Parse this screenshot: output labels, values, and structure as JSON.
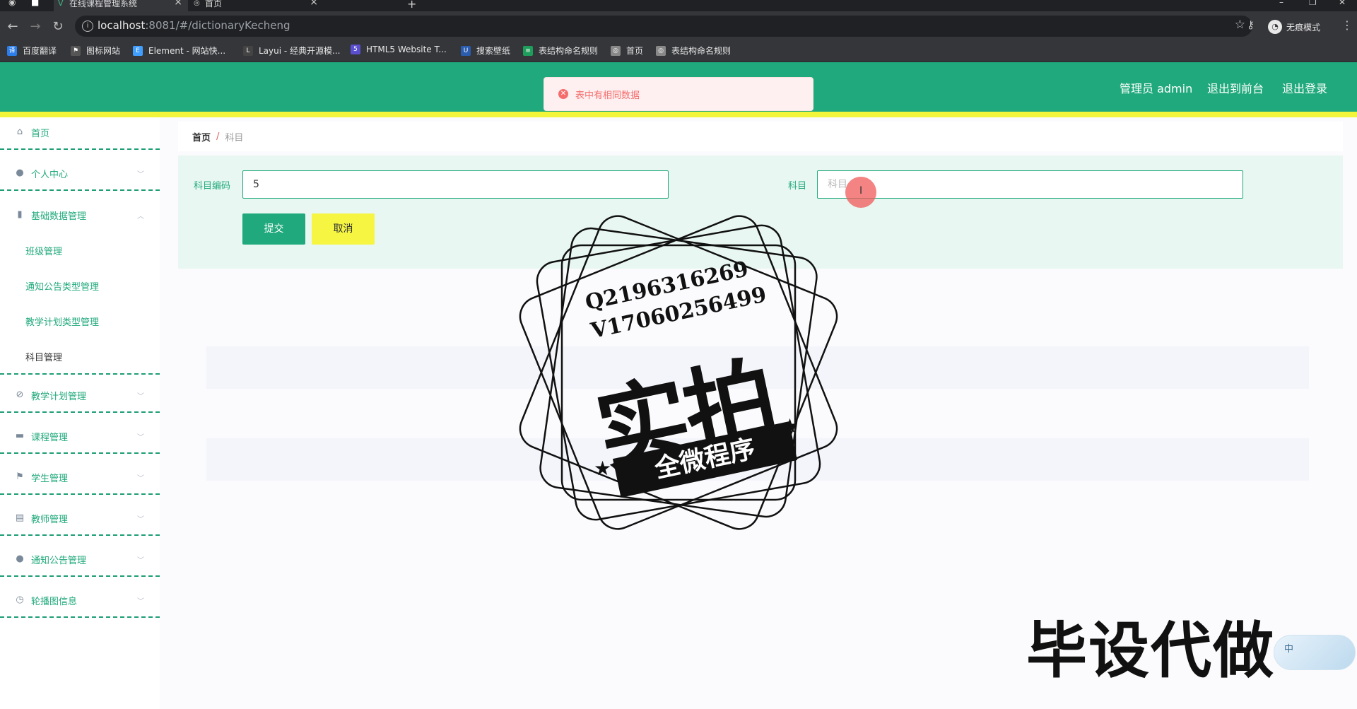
{
  "browser": {
    "tabs": [
      {
        "title": "在线课程管理系统",
        "active": true
      },
      {
        "title": "首页",
        "active": false
      }
    ],
    "url_host": "localhost",
    "url_rest": ":8081/#/dictionaryKecheng",
    "profile_label": "无痕模式",
    "bookmarks": [
      {
        "label": "百度翻译",
        "icon": "translate-icon",
        "color": "#2b7de9"
      },
      {
        "label": "图标网站",
        "icon": "flag-icon",
        "color": "#555555"
      },
      {
        "label": "Element - 网站快...",
        "icon": "element-icon",
        "color": "#409eff"
      },
      {
        "label": "Layui - 经典开源模...",
        "icon": "layui-icon",
        "color": "#444444"
      },
      {
        "label": "HTML5 Website T...",
        "icon": "html5-icon",
        "color": "#5a4fcf"
      },
      {
        "label": "搜索壁纸",
        "icon": "wallpaper-icon",
        "color": "#2a5db0"
      },
      {
        "label": "表结构命名规则",
        "icon": "sheet-icon",
        "color": "#1e9e5a"
      },
      {
        "label": "首页",
        "icon": "globe-icon",
        "color": "#888888"
      },
      {
        "label": "表结构命名规则",
        "icon": "globe-icon",
        "color": "#888888"
      }
    ]
  },
  "header": {
    "admin_label": "管理员 admin",
    "front_link": "退出到前台",
    "logout_link": "退出登录"
  },
  "toast": {
    "message": "表中有相同数据"
  },
  "sidebar": {
    "items": [
      {
        "label": "首页",
        "icon": "home-icon"
      },
      {
        "label": "个人中心",
        "icon": "user-icon"
      },
      {
        "label": "基础数据管理",
        "icon": "bar-chart-icon"
      },
      {
        "label": "教学计划管理",
        "icon": "plan-icon"
      },
      {
        "label": "课程管理",
        "icon": "briefcase-icon"
      },
      {
        "label": "学生管理",
        "icon": "flag-icon"
      },
      {
        "label": "教师管理",
        "icon": "clipboard-icon"
      },
      {
        "label": "通知公告管理",
        "icon": "user-icon"
      },
      {
        "label": "轮播图信息",
        "icon": "gauge-icon"
      }
    ],
    "subitems": [
      "班级管理",
      "通知公告类型管理",
      "教学计划类型管理",
      "科目管理"
    ]
  },
  "breadcrumb": {
    "home": "首页",
    "separator": "/",
    "current": "科目"
  },
  "form": {
    "code_label": "科目编码",
    "code_value": "5",
    "subject_label": "科目",
    "subject_placeholder": "科目",
    "submit_label": "提交",
    "cancel_label": "取消"
  },
  "watermark": {
    "line_q": "Q2196316269",
    "line_v": "V17060256499",
    "big": "实拍",
    "ribbon": "全微程序",
    "bottom": "毕设代做"
  },
  "ime": {
    "char": "中"
  },
  "colors": {
    "primary": "#20a97c",
    "accent_yellow": "#f3f53a",
    "error": "#f56c6c"
  }
}
